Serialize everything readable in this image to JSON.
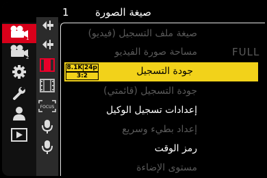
{
  "header": {
    "tab_number": "1",
    "title": "صيغة الصورة"
  },
  "sidebar_main": [
    {
      "icon": "video-camera-1-icon",
      "active": true
    },
    {
      "icon": "video-camera-2-icon",
      "active": false
    },
    {
      "icon": "gear-icon",
      "active": false
    },
    {
      "icon": "wrench-icon",
      "active": false
    },
    {
      "icon": "person-icon",
      "active": false
    },
    {
      "icon": "playback-icon",
      "active": false
    }
  ],
  "sidebar_sub": [
    {
      "icon": "crosshair-icon"
    },
    {
      "icon": "crosshair-icon"
    },
    {
      "icon": "filmstrip-icon-red"
    },
    {
      "icon": "filmstrip-icon"
    },
    {
      "icon": "focus-frame-icon",
      "text": "FOCUS"
    },
    {
      "icon": "microphone-icon"
    },
    {
      "icon": "microphone-icon"
    }
  ],
  "menu": {
    "items": [
      {
        "label": "صيغة ملف التسجيل (فيديو)",
        "state": "dim",
        "value": ""
      },
      {
        "label": "مساحة صورة الفيديو",
        "state": "dim",
        "value": "FULL"
      },
      {
        "label": "جودة التسجيل",
        "state": "selected",
        "value": ""
      },
      {
        "label": "جودة التسجيل (قائمتي)",
        "state": "dim",
        "value": ""
      },
      {
        "label": "إعدادات تسجيل الوكيل",
        "state": "bright",
        "value": ""
      },
      {
        "label": "إعداد بطيء وسريع",
        "state": "dim",
        "value": ""
      },
      {
        "label": "رمز الوقت",
        "state": "bright",
        "value": ""
      },
      {
        "label": "مستوى الإضاءة",
        "state": "dim",
        "value": ""
      }
    ],
    "selected_badge": {
      "resolution": "8.1K",
      "fps": "24p",
      "ratio": "3:2"
    }
  },
  "colors": {
    "accent_red": "#d8001a",
    "selection_yellow": "#f2d21a",
    "dim_text": "#5a5a5a"
  }
}
